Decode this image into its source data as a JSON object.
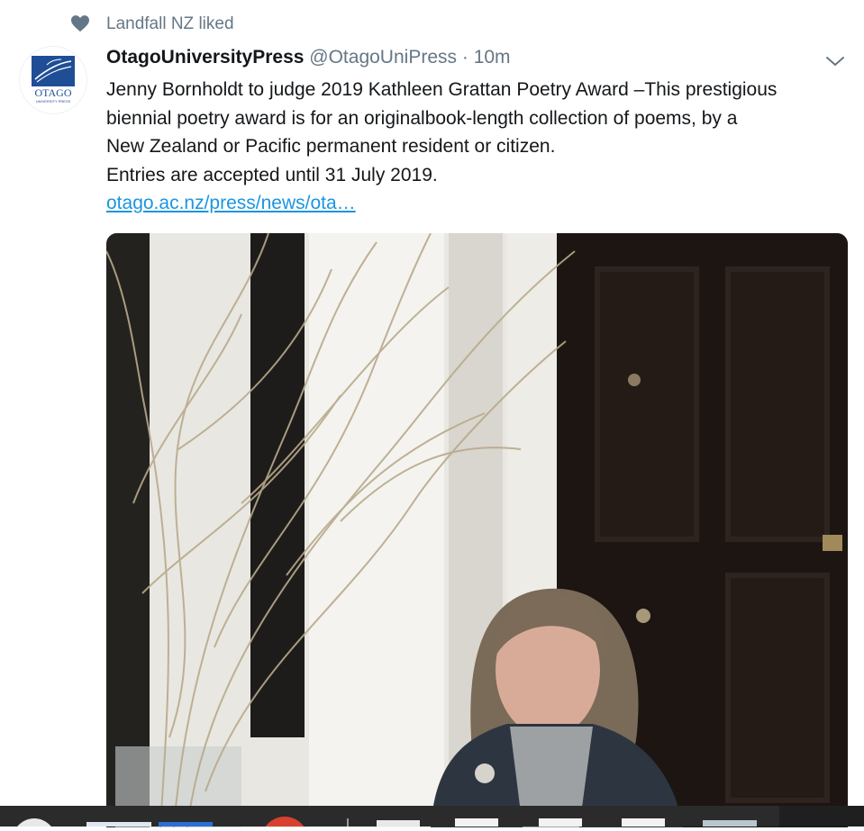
{
  "social_context": {
    "icon": "heart-icon",
    "text": "Landfall NZ liked"
  },
  "author": {
    "avatar_logo_text": "OTAGO",
    "avatar_logo_subtext": "UNIVERSITY PRESS",
    "display_name": "OtagoUniversityPress",
    "handle": "@OtagoUniPress",
    "separator": "·",
    "time": "10m"
  },
  "tweet": {
    "lines": [
      "Jenny Bornholdt to judge 2019 Kathleen Grattan Poetry Award –This prestigious",
      "biennial poetry award is for an originalbook-length collection of poems, by a",
      "New Zealand or Pacific permanent resident or citizen.",
      "Entries are accepted until 31 July 2019."
    ],
    "link_text": "otago.ac.nz/press/news/ota…",
    "more_icon": "chevron-down-icon"
  },
  "media": {
    "type": "photo",
    "subject": "woman-portrait-with-branches"
  },
  "colors": {
    "link": "#1b95e0",
    "secondary_text": "#657786",
    "heart": "#657786",
    "logo_blue": "#1f4e96"
  }
}
